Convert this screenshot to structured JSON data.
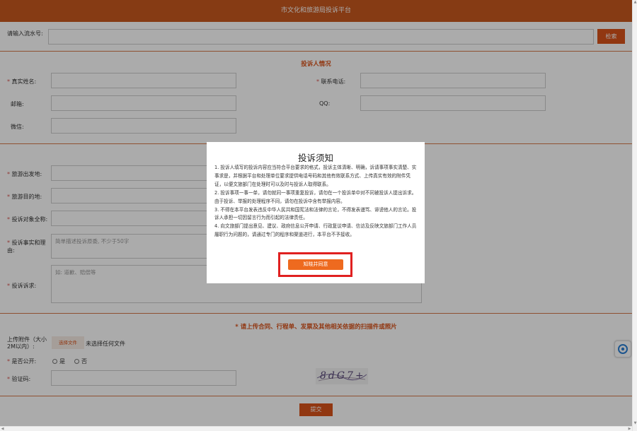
{
  "header": {
    "title": "市文化和旅游局投诉平台"
  },
  "search": {
    "label": "请输入流水号:",
    "value": "",
    "button": "检索"
  },
  "complainant": {
    "section_title": "投诉人情况",
    "name_label": "真实姓名:",
    "phone_label": "联系电话:",
    "email_label": "邮箱:",
    "qq_label": "QQ:",
    "wechat_label": "微信:"
  },
  "complaint": {
    "departure_label": "旅游出发地:",
    "destination_label": "旅游目的地:",
    "target_label": "投诉对象全称:",
    "facts_label": "投诉事实和理由:",
    "facts_placeholder": "简单描述投诉原委, 不少于50字",
    "demand_label": "投诉诉求:",
    "demand_placeholder": "如: 道歉、赔偿等"
  },
  "upload": {
    "section_title": "* 请上传合同、行程单、发票及其他相关依据的扫描件或照片",
    "attach_label": "上传附件（大小2M以内）:",
    "file_button": "选择文件",
    "file_status": "未选择任何文件",
    "public_label": "是否公开:",
    "yes_label": "是",
    "no_label": "否",
    "captcha_label": "验证码:",
    "captcha_text": "8dG7+"
  },
  "submit": {
    "label": "提交"
  },
  "modal": {
    "title": "投诉须知",
    "items": [
      "1. 投诉人填写的投诉内容应当符合平台要求的格式，投诉主体清晰、明确，诉请事项事实清楚、实事求是，并根据平台和处理单位要求提供电话号码和其他有效联系方式、上传真实有效的附件凭证，以便文旅部门在处理时可以及时与投诉人取得联系。",
      "2. 投诉事项一事一单，请勿就同一事项重复投诉，请勿在一个投诉单中对不同被投诉人提出诉求。由于投诉、举报的处理程序不同，请勿在投诉中含有举报内容。",
      "3. 不得在本平台发表违反中华人民共和国宪法和法律的言论，不得发表谩骂、诽谤他人的言论。投诉人承担一切因留言行为而引起的法律责任。",
      "4. 向文旅部门提出意见、建议、政府信息公开申请、行政复议申请、信访及反映文旅部门工作人员履职行为问题的，请通过专门的程序和渠道进行，本平台不予接收。"
    ],
    "agree_button": "知晓并同意"
  },
  "colors": {
    "brand": "#c8581e",
    "accent": "#d9521a",
    "agree": "#ee6a1f",
    "highlight": "#e02020"
  }
}
